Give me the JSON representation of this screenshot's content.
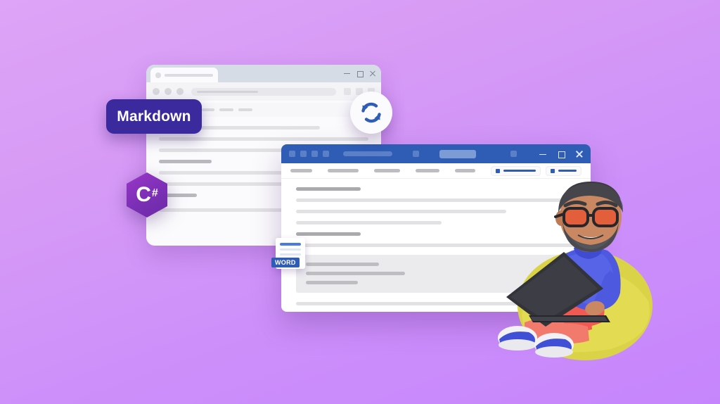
{
  "scene": {
    "title": "Markdown to Word conversion illustration",
    "background_top_color": "#dda4f7",
    "background_bottom_color": "#c685fc"
  },
  "markdown_badge": {
    "label": "Markdown",
    "background_color": "#3a2a9e",
    "text_color": "#ffffff"
  },
  "csharp_logo": {
    "letter": "C",
    "sharp": "#",
    "background_color": "#7b2fb5",
    "icon_name": "csharp-hexagon-icon"
  },
  "sync_icon": {
    "icon_name": "sync-arrows-icon",
    "arrow_color": "#2f5cb5",
    "circle_color": "#fbfbfd"
  },
  "word_icon": {
    "badge_label": "WORD",
    "badge_color": "#2f5cb5",
    "page_color": "#ffffff",
    "icon_name": "word-document-icon"
  },
  "back_window": {
    "name": "markdown-editor-window",
    "tabbar_color": "#d6dce6",
    "controls": [
      "minimize",
      "maximize",
      "close"
    ],
    "toolbar_dots": 3,
    "toolbar_squares": 3,
    "ribbon_chips": 1,
    "ribbon_bars": [
      24,
      18,
      20,
      20
    ],
    "content_lines": [
      77,
      100,
      66,
      25,
      80,
      92,
      18,
      100
    ]
  },
  "front_window": {
    "name": "word-document-window",
    "titlebar_color": "#2f5cb5",
    "title_dots": 4,
    "controls": [
      "minimize",
      "maximize",
      "close"
    ],
    "menu_items": [
      36,
      52,
      42,
      40,
      34
    ],
    "action_buttons": [
      {
        "name": "primary-action",
        "line_width": 46
      },
      {
        "name": "secondary-action",
        "line_width": 26
      }
    ],
    "content": {
      "heading_1": 23,
      "body_lines": [
        100,
        75,
        52
      ],
      "heading_2": 23,
      "body_line_2": 100,
      "code_block_lines": [
        28,
        38,
        20
      ],
      "footer_line": 92
    }
  },
  "character": {
    "name": "developer-on-beanbag",
    "shirt_color": "#4d5ae0",
    "pants_color": "#f05a52",
    "shoe_color": "#3f4fd6",
    "beanbag_color": "#e0d94a",
    "laptop_color": "#33343a",
    "glasses_lens_color": "#e35f3c",
    "skin_color": "#c98862",
    "hair_color": "#3a3a3f"
  }
}
